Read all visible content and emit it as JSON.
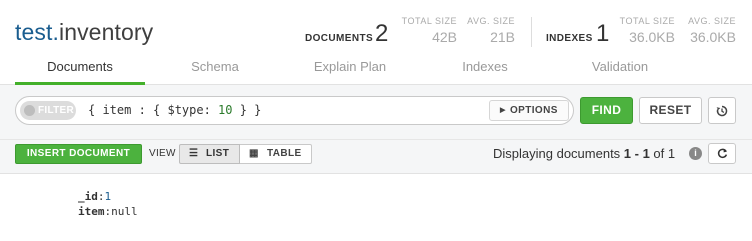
{
  "header": {
    "database": "test",
    "separator": ".",
    "collection": "inventory",
    "documents_label": "DOCUMENTS",
    "documents_count": "2",
    "total_size_label": "TOTAL SIZE",
    "total_size_value": "42B",
    "avg_size_label": "AVG. SIZE",
    "avg_size_value": "21B",
    "indexes_label": "INDEXES",
    "indexes_count": "1",
    "index_total_size_label": "TOTAL SIZE",
    "index_total_size_value": "36.0KB",
    "index_avg_size_label": "AVG. SIZE",
    "index_avg_size_value": "36.0KB"
  },
  "tabs": [
    {
      "label": "Documents",
      "active": true
    },
    {
      "label": "Schema",
      "active": false
    },
    {
      "label": "Explain Plan",
      "active": false
    },
    {
      "label": "Indexes",
      "active": false
    },
    {
      "label": "Validation",
      "active": false
    }
  ],
  "querybar": {
    "filter_label": "FILTER",
    "query_prefix": "{ item : { $type: ",
    "query_number": "10",
    "query_suffix": " } }",
    "options_label": "OPTIONS",
    "find_label": "FIND",
    "reset_label": "RESET",
    "history_icon": "history-icon"
  },
  "toolbar": {
    "insert_label": "INSERT DOCUMENT",
    "view_label": "VIEW",
    "list_label": "LIST",
    "table_label": "TABLE",
    "displaying_prefix": "Displaying documents ",
    "displaying_range": "1 - 1",
    "displaying_of": " of ",
    "displaying_total": "1",
    "info_icon": "info-icon",
    "refresh_icon": "refresh-icon"
  },
  "document": {
    "fields": [
      {
        "key": "_id",
        "value": "1"
      },
      {
        "key": "item",
        "value": "null"
      }
    ]
  },
  "colors": {
    "accent_green": "#4cb23e",
    "db_blue": "#1a5d8f"
  }
}
